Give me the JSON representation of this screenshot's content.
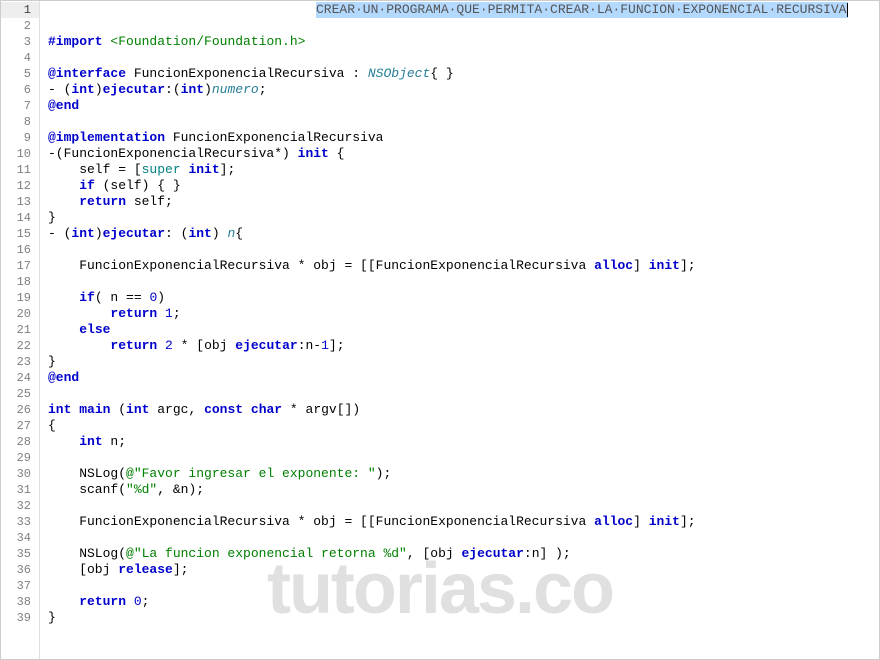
{
  "editor": {
    "active_line": 1,
    "lines": [
      {
        "n": 1,
        "tokens": [
          {
            "t": "comment_selected",
            "v": "CREAR UN PROGRAMA QUE PERMITA CREAR LA FUNCION EXPONENCIAL RECURSIVA"
          }
        ]
      },
      {
        "n": 2,
        "tokens": []
      },
      {
        "n": 3,
        "tokens": [
          {
            "t": "dir",
            "v": "#import "
          },
          {
            "t": "inc",
            "v": "<Foundation/Foundation.h>"
          }
        ]
      },
      {
        "n": 4,
        "tokens": []
      },
      {
        "n": 5,
        "tokens": [
          {
            "t": "at",
            "v": "@interface"
          },
          {
            "t": "pln",
            "v": " FuncionExponencialRecursiva : "
          },
          {
            "t": "type",
            "v": "NSObject"
          },
          {
            "t": "pln",
            "v": "{ }"
          }
        ]
      },
      {
        "n": 6,
        "tokens": [
          {
            "t": "pln",
            "v": "- ("
          },
          {
            "t": "kw",
            "v": "int"
          },
          {
            "t": "pln",
            "v": ")"
          },
          {
            "t": "msg",
            "v": "ejecutar"
          },
          {
            "t": "pln",
            "v": ":("
          },
          {
            "t": "kw",
            "v": "int"
          },
          {
            "t": "pln",
            "v": ")"
          },
          {
            "t": "type",
            "v": "numero"
          },
          {
            "t": "pln",
            "v": ";"
          }
        ]
      },
      {
        "n": 7,
        "tokens": [
          {
            "t": "at",
            "v": "@end"
          }
        ]
      },
      {
        "n": 8,
        "tokens": []
      },
      {
        "n": 9,
        "tokens": [
          {
            "t": "at",
            "v": "@implementation"
          },
          {
            "t": "pln",
            "v": " FuncionExponencialRecursiva"
          }
        ]
      },
      {
        "n": 10,
        "tokens": [
          {
            "t": "pln",
            "v": "-(FuncionExponencialRecursiva*) "
          },
          {
            "t": "msg",
            "v": "init"
          },
          {
            "t": "pln",
            "v": " {"
          }
        ]
      },
      {
        "n": 11,
        "tokens": [
          {
            "t": "pln",
            "v": "    self = ["
          },
          {
            "t": "sup",
            "v": "super"
          },
          {
            "t": "pln",
            "v": " "
          },
          {
            "t": "msg",
            "v": "init"
          },
          {
            "t": "pln",
            "v": "];"
          }
        ]
      },
      {
        "n": 12,
        "tokens": [
          {
            "t": "pln",
            "v": "    "
          },
          {
            "t": "kw",
            "v": "if"
          },
          {
            "t": "pln",
            "v": " (self) { }"
          }
        ]
      },
      {
        "n": 13,
        "tokens": [
          {
            "t": "pln",
            "v": "    "
          },
          {
            "t": "kw",
            "v": "return"
          },
          {
            "t": "pln",
            "v": " self;"
          }
        ]
      },
      {
        "n": 14,
        "tokens": [
          {
            "t": "pln",
            "v": "}"
          }
        ]
      },
      {
        "n": 15,
        "tokens": [
          {
            "t": "pln",
            "v": "- ("
          },
          {
            "t": "kw",
            "v": "int"
          },
          {
            "t": "pln",
            "v": ")"
          },
          {
            "t": "msg",
            "v": "ejecutar"
          },
          {
            "t": "pln",
            "v": ": ("
          },
          {
            "t": "kw",
            "v": "int"
          },
          {
            "t": "pln",
            "v": ") "
          },
          {
            "t": "type",
            "v": "n"
          },
          {
            "t": "pln",
            "v": "{"
          }
        ]
      },
      {
        "n": 16,
        "tokens": []
      },
      {
        "n": 17,
        "tokens": [
          {
            "t": "pln",
            "v": "    FuncionExponencialRecursiva * obj = [[FuncionExponencialRecursiva "
          },
          {
            "t": "msg",
            "v": "alloc"
          },
          {
            "t": "pln",
            "v": "] "
          },
          {
            "t": "msg",
            "v": "init"
          },
          {
            "t": "pln",
            "v": "];"
          }
        ]
      },
      {
        "n": 18,
        "tokens": []
      },
      {
        "n": 19,
        "tokens": [
          {
            "t": "pln",
            "v": "    "
          },
          {
            "t": "kw",
            "v": "if"
          },
          {
            "t": "pln",
            "v": "( n == "
          },
          {
            "t": "num",
            "v": "0"
          },
          {
            "t": "pln",
            "v": ")"
          }
        ]
      },
      {
        "n": 20,
        "tokens": [
          {
            "t": "pln",
            "v": "        "
          },
          {
            "t": "kw",
            "v": "return"
          },
          {
            "t": "pln",
            "v": " "
          },
          {
            "t": "num",
            "v": "1"
          },
          {
            "t": "pln",
            "v": ";"
          }
        ]
      },
      {
        "n": 21,
        "tokens": [
          {
            "t": "pln",
            "v": "    "
          },
          {
            "t": "kw",
            "v": "else"
          }
        ]
      },
      {
        "n": 22,
        "tokens": [
          {
            "t": "pln",
            "v": "        "
          },
          {
            "t": "kw",
            "v": "return"
          },
          {
            "t": "pln",
            "v": " "
          },
          {
            "t": "num",
            "v": "2"
          },
          {
            "t": "pln",
            "v": " * [obj "
          },
          {
            "t": "msg",
            "v": "ejecutar"
          },
          {
            "t": "pln",
            "v": ":n-"
          },
          {
            "t": "num",
            "v": "1"
          },
          {
            "t": "pln",
            "v": "];"
          }
        ]
      },
      {
        "n": 23,
        "tokens": [
          {
            "t": "pln",
            "v": "}"
          }
        ]
      },
      {
        "n": 24,
        "tokens": [
          {
            "t": "at",
            "v": "@end"
          }
        ]
      },
      {
        "n": 25,
        "tokens": []
      },
      {
        "n": 26,
        "tokens": [
          {
            "t": "kw",
            "v": "int"
          },
          {
            "t": "pln",
            "v": " "
          },
          {
            "t": "msg",
            "v": "main"
          },
          {
            "t": "pln",
            "v": " ("
          },
          {
            "t": "kw",
            "v": "int"
          },
          {
            "t": "pln",
            "v": " argc, "
          },
          {
            "t": "kw",
            "v": "const"
          },
          {
            "t": "pln",
            "v": " "
          },
          {
            "t": "kw",
            "v": "char"
          },
          {
            "t": "pln",
            "v": " * argv[])"
          }
        ]
      },
      {
        "n": 27,
        "tokens": [
          {
            "t": "pln",
            "v": "{"
          }
        ]
      },
      {
        "n": 28,
        "tokens": [
          {
            "t": "pln",
            "v": "    "
          },
          {
            "t": "kw",
            "v": "int"
          },
          {
            "t": "pln",
            "v": " n;"
          }
        ]
      },
      {
        "n": 29,
        "tokens": []
      },
      {
        "n": 30,
        "tokens": [
          {
            "t": "pln",
            "v": "    NSLog("
          },
          {
            "t": "str",
            "v": "@\"Favor ingresar el exponente: \""
          },
          {
            "t": "pln",
            "v": ");"
          }
        ]
      },
      {
        "n": 31,
        "tokens": [
          {
            "t": "pln",
            "v": "    scanf("
          },
          {
            "t": "str",
            "v": "\"%d\""
          },
          {
            "t": "pln",
            "v": ", &n);"
          }
        ]
      },
      {
        "n": 32,
        "tokens": []
      },
      {
        "n": 33,
        "tokens": [
          {
            "t": "pln",
            "v": "    FuncionExponencialRecursiva * obj = [[FuncionExponencialRecursiva "
          },
          {
            "t": "msg",
            "v": "alloc"
          },
          {
            "t": "pln",
            "v": "] "
          },
          {
            "t": "msg",
            "v": "init"
          },
          {
            "t": "pln",
            "v": "];"
          }
        ]
      },
      {
        "n": 34,
        "tokens": []
      },
      {
        "n": 35,
        "tokens": [
          {
            "t": "pln",
            "v": "    NSLog("
          },
          {
            "t": "str",
            "v": "@\"La funcion exponencial retorna %d\""
          },
          {
            "t": "pln",
            "v": ", [obj "
          },
          {
            "t": "msg",
            "v": "ejecutar"
          },
          {
            "t": "pln",
            "v": ":n] );"
          }
        ]
      },
      {
        "n": 36,
        "tokens": [
          {
            "t": "pln",
            "v": "    [obj "
          },
          {
            "t": "msg",
            "v": "release"
          },
          {
            "t": "pln",
            "v": "];"
          }
        ]
      },
      {
        "n": 37,
        "tokens": []
      },
      {
        "n": 38,
        "tokens": [
          {
            "t": "pln",
            "v": "    "
          },
          {
            "t": "kw",
            "v": "return"
          },
          {
            "t": "pln",
            "v": " "
          },
          {
            "t": "num",
            "v": "0"
          },
          {
            "t": "pln",
            "v": ";"
          }
        ]
      },
      {
        "n": 39,
        "tokens": [
          {
            "t": "pln",
            "v": "}"
          }
        ]
      }
    ]
  },
  "watermark": "tutorias.co"
}
